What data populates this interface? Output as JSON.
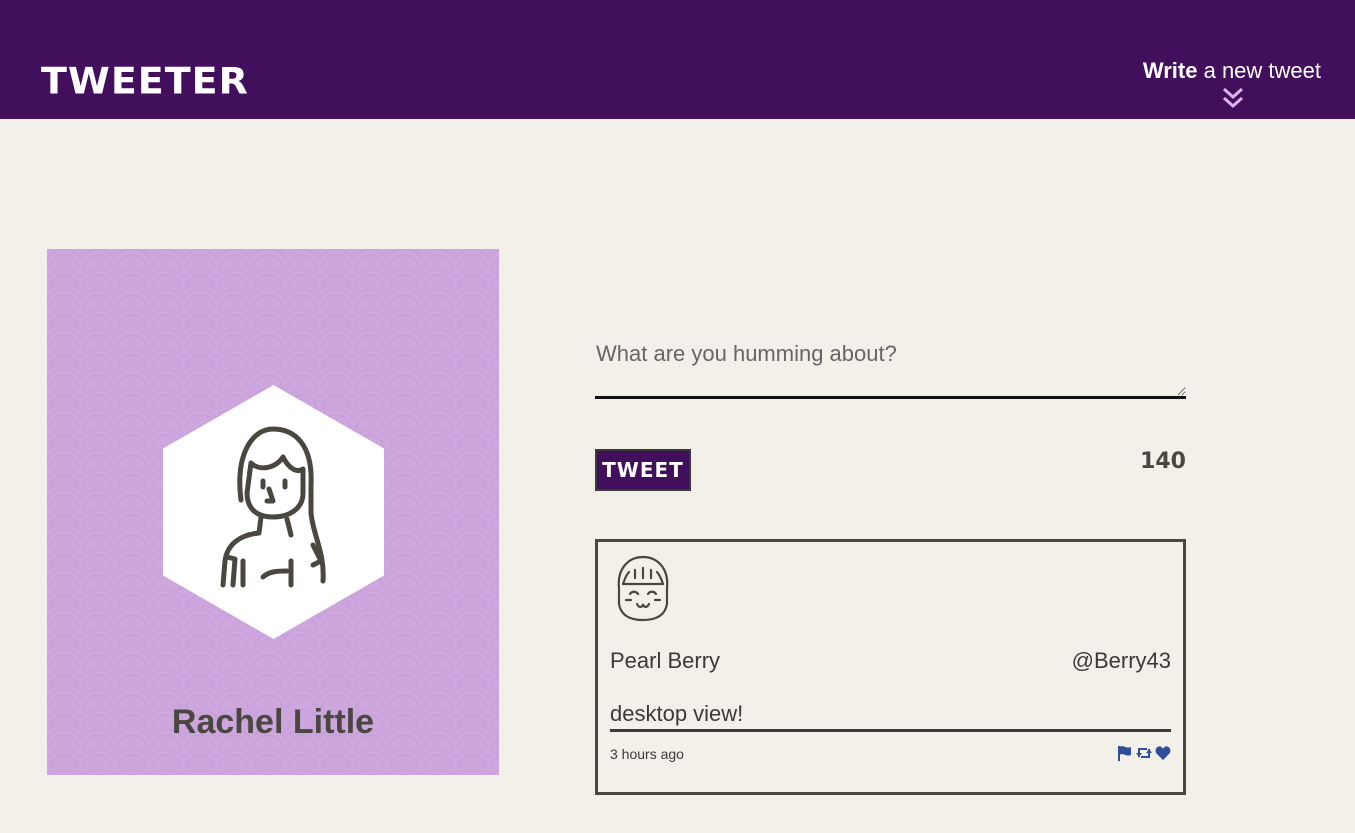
{
  "header": {
    "brand": "TWEETER",
    "compose_bold": "Write",
    "compose_rest": " a new tweet",
    "compose_icon": "double-chevron-down-icon"
  },
  "profile": {
    "name": "Rachel Little",
    "avatar_icon": "woman-avatar-icon"
  },
  "compose": {
    "placeholder": "What are you humming about?",
    "value": "",
    "button_label": "TWEET",
    "counter": "140"
  },
  "tweets": [
    {
      "author": "Pearl Berry",
      "handle": "@Berry43",
      "body": "desktop view!",
      "time": "3 hours ago",
      "avatar_icon": "girl-avatar-icon",
      "actions": [
        "flag-icon",
        "retweet-icon",
        "heart-icon"
      ]
    }
  ],
  "colors": {
    "nav": "#420f5c",
    "background": "#f3efe9",
    "profile_bg": "#cca6dd",
    "text": "#4a4640",
    "action_icons": "#2f4f9a"
  }
}
